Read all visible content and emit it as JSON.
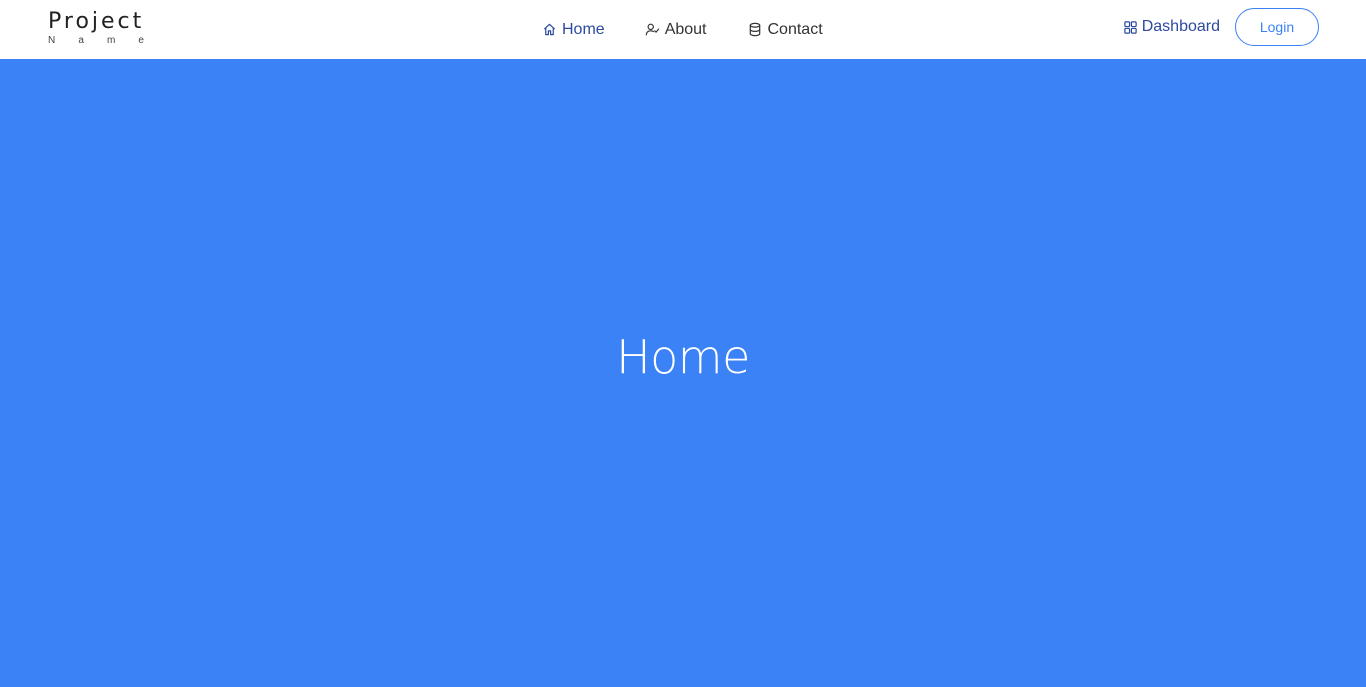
{
  "brand": {
    "title": "Project",
    "subtitle_letters": [
      "N",
      "a",
      "m",
      "e"
    ]
  },
  "nav": {
    "items": [
      {
        "label": "Home",
        "icon": "home-icon",
        "active": true
      },
      {
        "label": "About",
        "icon": "user-check-icon",
        "active": false
      },
      {
        "label": "Contact",
        "icon": "database-icon",
        "active": false
      }
    ],
    "dashboard_label": "Dashboard",
    "dashboard_icon": "grid-icon",
    "login_label": "Login"
  },
  "hero": {
    "title": "Home"
  },
  "colors": {
    "accent": "#3b82f6",
    "nav_active": "#2c4a9e",
    "text": "#333333"
  }
}
